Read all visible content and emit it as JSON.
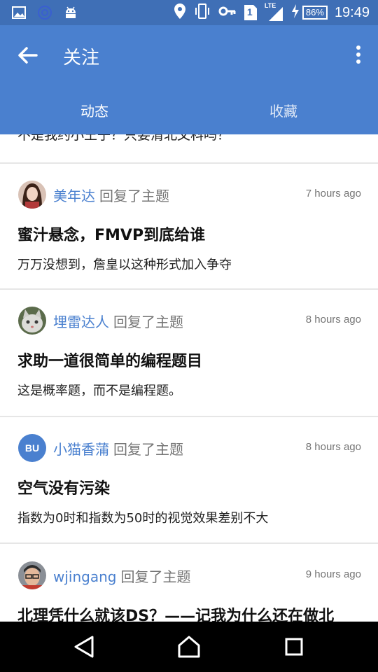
{
  "status_bar": {
    "battery": "86%",
    "network": "LTE",
    "sim": "1",
    "time": "19:49",
    "icons": [
      "image-icon",
      "sync-icon",
      "android-icon",
      "location-icon",
      "vibrate-icon",
      "key-icon",
      "sim-icon",
      "signal-icon",
      "charging-icon",
      "battery-icon"
    ]
  },
  "toolbar": {
    "title": "关注",
    "back_icon": "arrow-left-icon",
    "more_icon": "more-vertical-icon"
  },
  "tabs": [
    {
      "label": "动态",
      "active": true
    },
    {
      "label": "收藏",
      "active": false
    }
  ],
  "feed": {
    "partial_top_text": "不是我约小王子？只要清北文科吗？",
    "items": [
      {
        "user": "美年达",
        "action": "回复了主题",
        "time": "7 hours ago",
        "title": "蜜汁悬念，FMVP到底给谁",
        "excerpt": "万万没想到，詹皇以这种形式加入争夺",
        "avatar": "photo"
      },
      {
        "user": "埋雷达人",
        "action": "回复了主题",
        "time": "8 hours ago",
        "title": "求助一道很简单的编程题目",
        "excerpt": "这是概率题，而不是编程题。",
        "avatar": "cat"
      },
      {
        "user": "小猫香蒲",
        "action": "回复了主题",
        "time": "8 hours ago",
        "title": "空气没有污染",
        "excerpt": "指数为0时和指数为50时的视觉效果差别不大",
        "avatar": "BU"
      },
      {
        "user": "wjingang",
        "action": "回复了主题",
        "time": "9 hours ago",
        "title": "北理凭什么就该DS？——记我为什么还在做北",
        "excerpt": "",
        "avatar": "photo"
      }
    ]
  },
  "nav_bar": {
    "buttons": [
      "back-triangle-icon",
      "home-icon",
      "recents-icon"
    ]
  },
  "colors": {
    "primary": "#4a80cf",
    "status_bar": "#3f6fb6",
    "link": "#4a80cf"
  }
}
